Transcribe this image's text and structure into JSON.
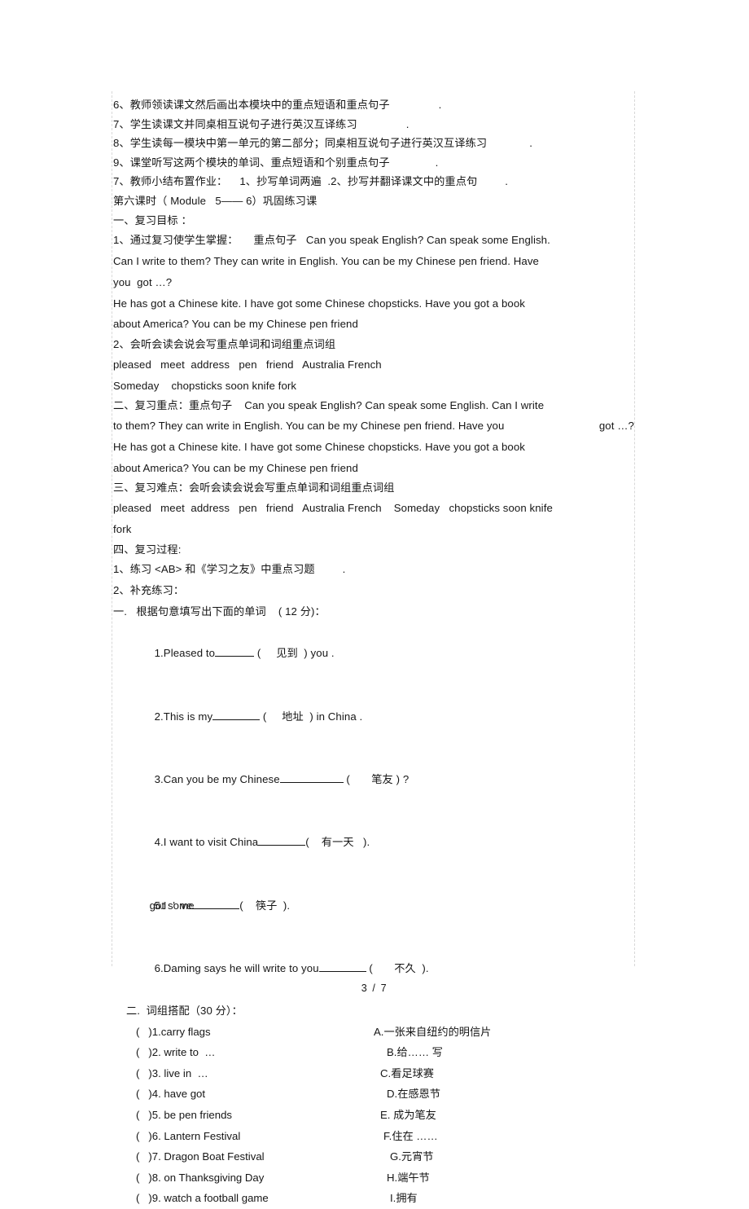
{
  "document": {
    "footer": "3 / 7"
  },
  "lesson_steps": [
    "6、教师领读课文然后画出本模块中的重点短语和重点句子",
    "7、学生读课文并同桌相互说句子进行英汉互译练习",
    "8、学生读每一模块中第一单元的第二部分；同桌相互说句子进行英汉互译练习",
    "9、课堂听写这两个模块的单词、重点短语和个别重点句子",
    "7、教师小结布置作业：    1、抄写单词两遍  .2、抄写并翻译课文中的重点句"
  ],
  "lesson_step_trailing_dots": [
    ".",
    ".",
    ".",
    ".",
    "."
  ],
  "period_heading": "第六课时（ Module   5—— 6）巩固练习课",
  "section_one": {
    "heading": "一、复习目标 ：",
    "item1_prefix": "1、通过复习使学生掌握：     重点句子   Can you speak English? Can speak some English.",
    "item1_cont": [
      "Can I write to them? They can write in English. You can be my Chinese pen friend. Have",
      "you  got …?"
    ],
    "item1_extra": [
      "He has got a Chinese kite. I have got some Chinese chopsticks. Have you got a book",
      "about America? You can be my Chinese pen friend"
    ],
    "item2_heading": "2、会听会读会说会写重点单词和词组重点词组",
    "item2_words": [
      "pleased   meet  address   pen   friend   Australia French",
      "Someday    chopsticks soon knife fork"
    ]
  },
  "section_two": {
    "heading_line": "二、复习重点：重点句子    Can you speak English? Can speak some English. Can I write",
    "wrapped_line_left": "to them? They can write in English. You can be my Chinese pen friend. Have you",
    "wrapped_line_right": "got …?",
    "extra": [
      "He has got a Chinese kite. I have got some Chinese chopsticks. Have you got a book",
      "about America? You can be my Chinese pen friend"
    ]
  },
  "section_three": {
    "heading": "三、复习难点：会听会读会说会写重点单词和词组重点词组",
    "words": [
      "pleased   meet  address   pen   friend   Australia French    Someday   chopsticks soon knife",
      "fork"
    ]
  },
  "section_four": {
    "heading": "四、复习过程:",
    "item1": "1、练习 <AB> 和《学习之友》中重点习题",
    "item1_trailing": ".",
    "item2": "2、补充练习："
  },
  "exercise_one": {
    "heading": "一.   根据句意填写出下面的单词    ( 12 分)：",
    "items": [
      {
        "num": "1.",
        "before": "Pleased to",
        "blank": "blank-s",
        "hint": "(     见到  ) you .",
        "after": ""
      },
      {
        "num": "2.",
        "before": "This is my",
        "blank": "blank-m",
        "hint": "(     地址  ) in China .",
        "after": ""
      },
      {
        "num": "3.",
        "before": "Can you be my Chinese",
        "blank": "blank-l",
        "hint": "(       笔友 ) ?",
        "after": ""
      },
      {
        "num": "4.",
        "before": "I want to visit China",
        "blank": "blank-m",
        "hint": "(    有一天   ).",
        "after": ""
      },
      {
        "num": "5.",
        "before": "I  ’ ve got some",
        "blank": "blank-m",
        "hint": "(    筷子  ).",
        "after": ""
      },
      {
        "num": "6.",
        "before": "Daming says he will write to you",
        "blank": "blank-m",
        "hint": "(       不久  ).",
        "after": ""
      }
    ],
    "item5_overlap": {
      "base": "5.I  ’  ve",
      "overlay": "got some"
    }
  },
  "exercise_two": {
    "heading": "二.  词组搭配（30 分）：",
    "rows": [
      {
        "left": "(   )1.carry flags",
        "right": "A.一张来自纽约的明信片"
      },
      {
        "left": "(   )2. write to  …",
        "right": "B.给…… 写"
      },
      {
        "left": "(   )3. live in  …",
        "right": "C.看足球赛"
      },
      {
        "left": "(   )4. have got",
        "right": "D.在感恩节"
      },
      {
        "left": "(   )5. be pen friends",
        "right": "E. 成为笔友"
      },
      {
        "left": "(   )6. Lantern Festival",
        "right": "F.住在 ……"
      },
      {
        "left": "(   )7. Dragon Boat Festival",
        "right": "G.元宵节"
      },
      {
        "left": "(   )8. on Thanksgiving Day",
        "right": "H.端午节"
      },
      {
        "left": "(   )9. watch a football game",
        "right": "I.拥有"
      }
    ],
    "right_indents": [
      62,
      78,
      70,
      78,
      70,
      74,
      82,
      78,
      82
    ]
  }
}
